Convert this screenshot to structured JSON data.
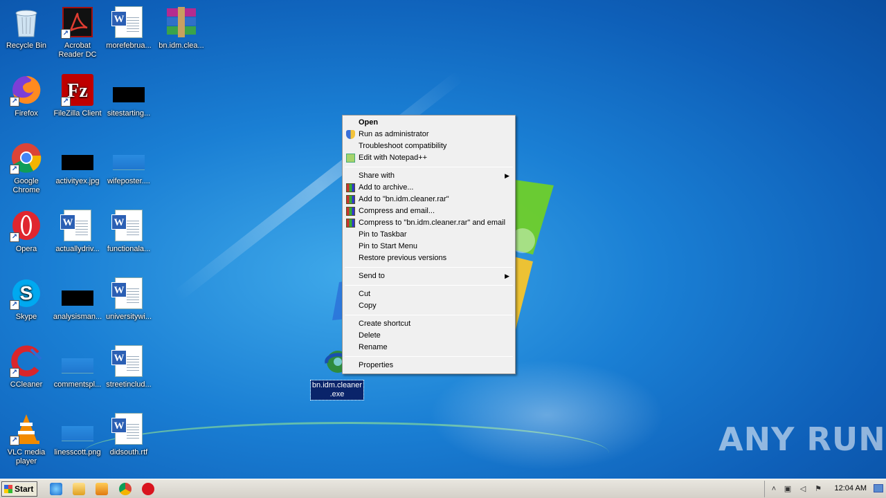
{
  "desktop": {
    "icons": [
      {
        "label": "Recycle Bin"
      },
      {
        "label": "Acrobat Reader DC"
      },
      {
        "label": "morefebrua..."
      },
      {
        "label": "bn.idm.clea..."
      },
      {
        "label": "Firefox"
      },
      {
        "label": "FileZilla Client"
      },
      {
        "label": "sitestarting..."
      },
      {
        "label": "Google Chrome"
      },
      {
        "label": "activityex.jpg"
      },
      {
        "label": "wifeposter...."
      },
      {
        "label": "Opera"
      },
      {
        "label": "actuallydriv..."
      },
      {
        "label": "functionala..."
      },
      {
        "label": "Skype"
      },
      {
        "label": "analysisman..."
      },
      {
        "label": "universitywi..."
      },
      {
        "label": "CCleaner"
      },
      {
        "label": "commentspl..."
      },
      {
        "label": "streetinclud..."
      },
      {
        "label": "VLC media player"
      },
      {
        "label": "linesscott.png"
      },
      {
        "label": "didsouth.rtf"
      },
      {
        "label": "bn.idm.cleaner .exe"
      }
    ]
  },
  "context_menu": {
    "items": [
      {
        "label": "Open"
      },
      {
        "label": "Run as administrator"
      },
      {
        "label": "Troubleshoot compatibility"
      },
      {
        "label": "Edit with Notepad++"
      },
      {
        "label": "Share with"
      },
      {
        "label": "Add to archive..."
      },
      {
        "label": "Add to \"bn.idm.cleaner.rar\""
      },
      {
        "label": "Compress and email..."
      },
      {
        "label": "Compress to \"bn.idm.cleaner.rar\" and email"
      },
      {
        "label": "Pin to Taskbar"
      },
      {
        "label": "Pin to Start Menu"
      },
      {
        "label": "Restore previous versions"
      },
      {
        "label": "Send to"
      },
      {
        "label": "Cut"
      },
      {
        "label": "Copy"
      },
      {
        "label": "Create shortcut"
      },
      {
        "label": "Delete"
      },
      {
        "label": "Rename"
      },
      {
        "label": "Properties"
      }
    ]
  },
  "taskbar": {
    "start_label": "Start",
    "clock": "12:04 AM"
  },
  "watermark": "ANY RUN"
}
